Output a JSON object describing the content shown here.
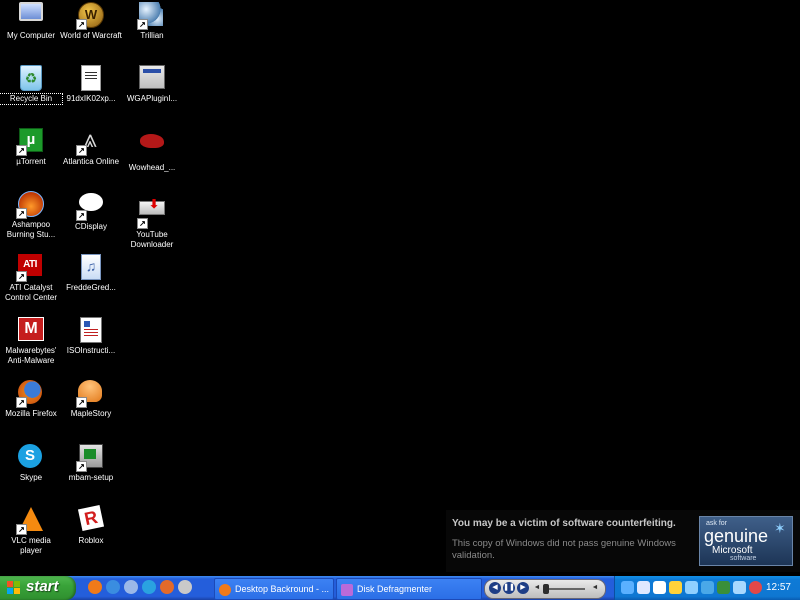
{
  "desktop": {
    "icons": {
      "my_computer": "My Computer",
      "wow": "World of Warcraft",
      "trillian": "Trillian",
      "recycle_bin": "Recycle Bin",
      "doc91": "91dxIK02xp...",
      "wga": "WGAPluginI...",
      "utorrent": "µTorrent",
      "atlantica": "Atlantica Online",
      "wowhead": "Wowhead_...",
      "ashampoo": "Ashampoo Burning Stu...",
      "cdisplay": "CDisplay",
      "youtube": "YouTube Downloader",
      "ati": "ATI Catalyst Control Center",
      "fredde": "FreddeGred...",
      "malwarebytes": "Malwarebytes' Anti-Malware",
      "iso": "ISOInstructi...",
      "firefox": "Mozilla Firefox",
      "maplestory": "MapleStory",
      "skype": "Skype",
      "mbam": "mbam-setup",
      "vlc": "VLC media player",
      "roblox": "Roblox"
    }
  },
  "notification": {
    "title": "You may be a victim of software counterfeiting.",
    "body": "This copy of Windows did not pass genuine Windows validation.",
    "badge_line1": "ask for",
    "badge_line2": "genuine",
    "badge_line3": "Microsoft",
    "badge_line4": "software"
  },
  "taskbar": {
    "start_label": "start",
    "tasks": {
      "firefox_task": "Desktop Backround - ...",
      "defrag_task": "Disk Defragmenter"
    },
    "clock": "12:57"
  },
  "colors": {
    "desktop_bg": "#000000",
    "taskbar_blue": "#245edb",
    "start_green": "#39a339",
    "tray_blue": "#0f77d2"
  }
}
